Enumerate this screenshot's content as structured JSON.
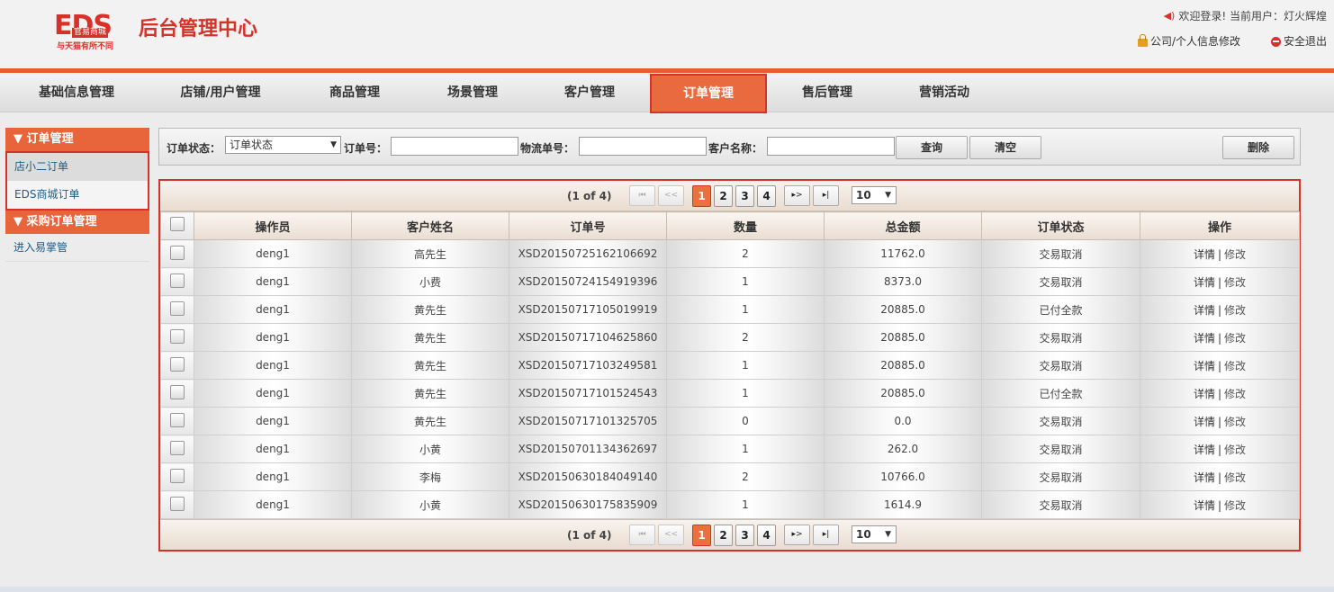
{
  "header": {
    "logo_eds": "EDS",
    "logo_sub": "官易商城",
    "logo_slogan": "与天猫有所不同",
    "logo_title": "后台管理中心",
    "welcome": "欢迎登录!  当前用户：灯火辉煌",
    "profile_link": "公司/个人信息修改",
    "logout_link": "安全退出"
  },
  "nav": {
    "items": [
      {
        "label": "基础信息管理"
      },
      {
        "label": "店铺/用户管理"
      },
      {
        "label": "商品管理"
      },
      {
        "label": "场景管理"
      },
      {
        "label": "客户管理"
      },
      {
        "label": "订单管理"
      },
      {
        "label": "售后管理"
      },
      {
        "label": "营销活动"
      }
    ],
    "active": "订单管理"
  },
  "sidebar": {
    "groups": [
      {
        "title": "▼ 订单管理",
        "items": [
          {
            "label": "店小二订单"
          },
          {
            "label": "EDS商城订单"
          }
        ]
      },
      {
        "title": "▼ 采购订单管理",
        "items": [
          {
            "label": "进入易掌管"
          }
        ]
      }
    ]
  },
  "search": {
    "status_label": "订单状态：",
    "status_value": "订单状态",
    "order_no_label": "订单号：",
    "order_no_value": "",
    "logistics_label": "物流单号：",
    "logistics_value": "",
    "customer_label": "客户名称：",
    "customer_value": "",
    "query_btn": "查询",
    "clear_btn": "清空",
    "delete_btn": "删除"
  },
  "pager": {
    "count": "(1 of 4)",
    "first": "⏮",
    "prev": "<<",
    "pages": [
      "1",
      "2",
      "3",
      "4"
    ],
    "current": "1",
    "next": "▸>",
    "last": "▸|",
    "page_size": "10"
  },
  "table": {
    "columns": [
      "操作员",
      "客户姓名",
      "订单号",
      "数量",
      "总金额",
      "订单状态",
      "操作"
    ],
    "action_detail": "详情",
    "action_sep": "|",
    "action_modify": "修改",
    "rows": [
      {
        "operator": "deng1",
        "customer": "高先生",
        "order_no": "XSD20150725162106692",
        "qty": "2",
        "total": "11762.0",
        "status": "交易取消"
      },
      {
        "operator": "deng1",
        "customer": "小费",
        "order_no": "XSD20150724154919396",
        "qty": "1",
        "total": "8373.0",
        "status": "交易取消"
      },
      {
        "operator": "deng1",
        "customer": "黄先生",
        "order_no": "XSD20150717105019919",
        "qty": "1",
        "total": "20885.0",
        "status": "已付全款"
      },
      {
        "operator": "deng1",
        "customer": "黄先生",
        "order_no": "XSD20150717104625860",
        "qty": "2",
        "total": "20885.0",
        "status": "交易取消"
      },
      {
        "operator": "deng1",
        "customer": "黄先生",
        "order_no": "XSD20150717103249581",
        "qty": "1",
        "total": "20885.0",
        "status": "交易取消"
      },
      {
        "operator": "deng1",
        "customer": "黄先生",
        "order_no": "XSD20150717101524543",
        "qty": "1",
        "total": "20885.0",
        "status": "已付全款"
      },
      {
        "operator": "deng1",
        "customer": "黄先生",
        "order_no": "XSD20150717101325705",
        "qty": "0",
        "total": "0.0",
        "status": "交易取消"
      },
      {
        "operator": "deng1",
        "customer": "小黄",
        "order_no": "XSD20150701134362697",
        "qty": "1",
        "total": "262.0",
        "status": "交易取消"
      },
      {
        "operator": "deng1",
        "customer": "李梅",
        "order_no": "XSD20150630184049140",
        "qty": "2",
        "total": "10766.0",
        "status": "交易取消"
      },
      {
        "operator": "deng1",
        "customer": "小黄",
        "order_no": "XSD20150630175835909",
        "qty": "1",
        "total": "1614.9",
        "status": "交易取消"
      }
    ]
  },
  "colors": {
    "accent": "#ea5b32",
    "brand_red": "#d6322a"
  }
}
